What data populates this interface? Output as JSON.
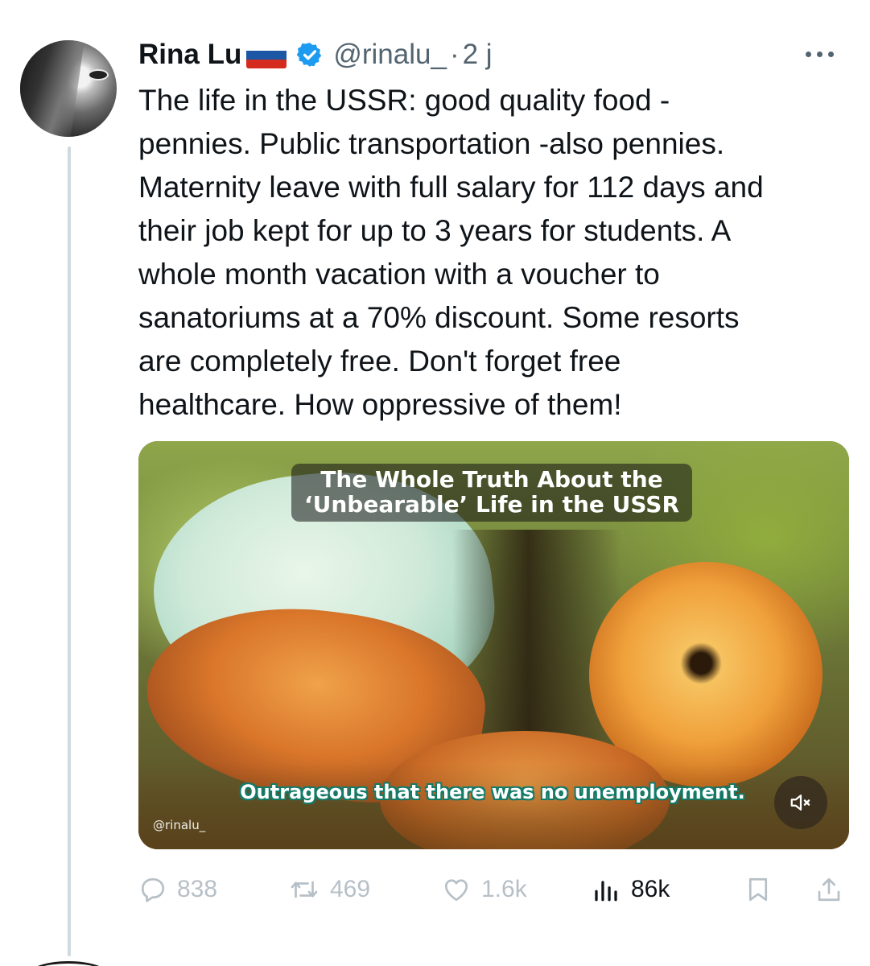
{
  "tweet": {
    "author": {
      "display_name": "Rina Lu",
      "flag": "russia-flag",
      "verified": true,
      "handle": "@rinalu_",
      "separator": "·",
      "timestamp": "2 j"
    },
    "text": "The life in the USSR: good quality food -\npennies. Public transportation -also pennies.\nMaternity leave with full salary for 112 days and\ntheir job kept for up to 3 years for students. A\nwhole month vacation with a voucher to\nsanatoriums at a 70% discount. Some resorts\nare completely free. Don't forget free\nhealthcare. How oppressive of them!",
    "media": {
      "video_title": "The Whole Truth About the\n‘Unbearable’ Life in the USSR",
      "caption": "Outrageous that there was no unemployment.",
      "watermark": "@rinalu_",
      "mute_icon": "volume-muted-icon"
    },
    "stats": {
      "replies": "838",
      "reposts": "469",
      "likes": "1.6k",
      "views": "86k"
    }
  },
  "colors": {
    "text": "#0f1419",
    "secondary": "#536471",
    "verified_blue": "#1d9bf0",
    "faded_action": "#b7c0c7",
    "thread_line": "#cfd9de"
  }
}
